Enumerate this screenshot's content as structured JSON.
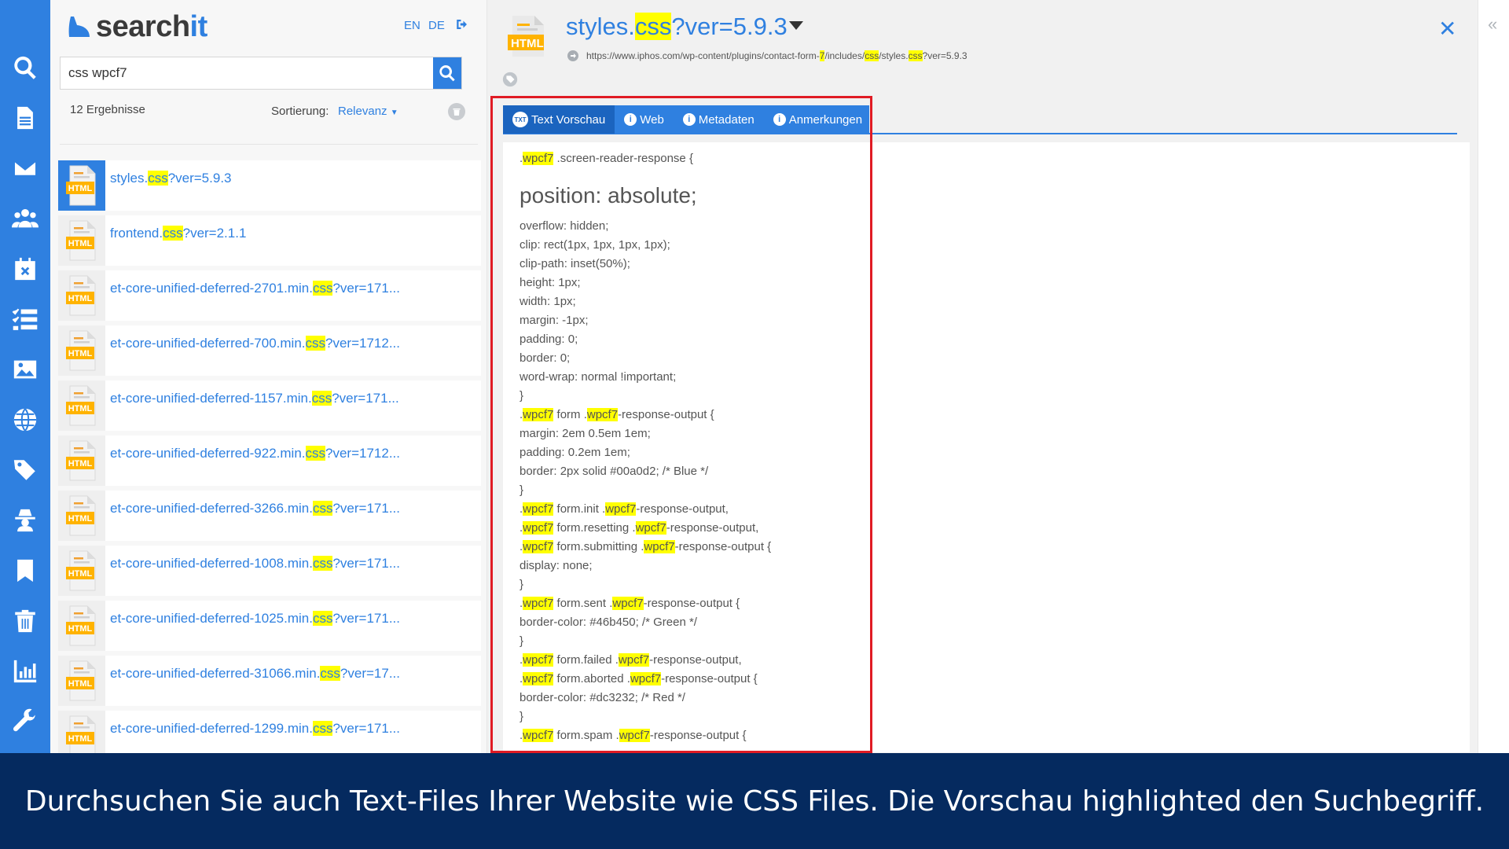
{
  "brand": {
    "name_prefix": "search",
    "name_suffix": "it"
  },
  "lang": {
    "en": "EN",
    "de": "DE"
  },
  "search": {
    "value": "css wpcf7",
    "placeholder": ""
  },
  "results_meta": {
    "count_text": "12 Ergebnisse",
    "sort_label": "Sortierung:",
    "sort_value": "Relevanz"
  },
  "results": [
    {
      "pre": "styles.",
      "hl": "css",
      "post": "?ver=5.9.3",
      "active": true
    },
    {
      "pre": "frontend.",
      "hl": "css",
      "post": "?ver=2.1.1",
      "active": false
    },
    {
      "pre": "et-core-unified-deferred-2701.min.",
      "hl": "css",
      "post": "?ver=171...",
      "active": false
    },
    {
      "pre": "et-core-unified-deferred-700.min.",
      "hl": "css",
      "post": "?ver=1712...",
      "active": false
    },
    {
      "pre": "et-core-unified-deferred-1157.min.",
      "hl": "css",
      "post": "?ver=171...",
      "active": false
    },
    {
      "pre": "et-core-unified-deferred-922.min.",
      "hl": "css",
      "post": "?ver=1712...",
      "active": false
    },
    {
      "pre": "et-core-unified-deferred-3266.min.",
      "hl": "css",
      "post": "?ver=171...",
      "active": false
    },
    {
      "pre": "et-core-unified-deferred-1008.min.",
      "hl": "css",
      "post": "?ver=171...",
      "active": false
    },
    {
      "pre": "et-core-unified-deferred-1025.min.",
      "hl": "css",
      "post": "?ver=171...",
      "active": false
    },
    {
      "pre": "et-core-unified-deferred-31066.min.",
      "hl": "css",
      "post": "?ver=17...",
      "active": false
    },
    {
      "pre": "et-core-unified-deferred-1299.min.",
      "hl": "css",
      "post": "?ver=171...",
      "active": false
    }
  ],
  "file_icon_label": "HTML",
  "detail": {
    "title_pre": "styles.",
    "title_hl": "css",
    "title_post": "?ver=5.9.3",
    "url_parts": [
      {
        "t": "https://www.iphos.com/wp-content/plugins/contact-form-"
      },
      {
        "t": "7",
        "h": true
      },
      {
        "t": "/includes/"
      },
      {
        "t": "css",
        "h": true
      },
      {
        "t": "/styles."
      },
      {
        "t": "css",
        "h": true
      },
      {
        "t": "?ver=5.9.3"
      }
    ]
  },
  "tabs": [
    {
      "label": "Text Vorschau",
      "badge": "TXT",
      "active": true
    },
    {
      "label": "Web",
      "badge": "i",
      "active": false
    },
    {
      "label": "Metadaten",
      "badge": "i",
      "active": false
    },
    {
      "label": "Anmerkungen",
      "badge": "i",
      "active": false
    }
  ],
  "preview_lines": [
    {
      "p": [
        [
          ".",
          0
        ],
        [
          "wpcf7",
          1
        ],
        [
          " .screen-reader-response {",
          0
        ]
      ]
    },
    {
      "big": true,
      "p": [
        [
          "position: absolute;",
          0
        ]
      ]
    },
    {
      "p": [
        [
          "overflow: hidden;",
          0
        ]
      ]
    },
    {
      "p": [
        [
          "clip: rect(1px, 1px, 1px, 1px);",
          0
        ]
      ]
    },
    {
      "p": [
        [
          "clip-path: inset(50%);",
          0
        ]
      ]
    },
    {
      "p": [
        [
          "height: 1px;",
          0
        ]
      ]
    },
    {
      "p": [
        [
          "width: 1px;",
          0
        ]
      ]
    },
    {
      "p": [
        [
          "margin: -1px;",
          0
        ]
      ]
    },
    {
      "p": [
        [
          "padding: 0;",
          0
        ]
      ]
    },
    {
      "p": [
        [
          "border: 0;",
          0
        ]
      ]
    },
    {
      "p": [
        [
          "word-wrap: normal !important;",
          0
        ]
      ]
    },
    {
      "p": [
        [
          "}",
          0
        ]
      ]
    },
    {
      "p": [
        [
          ".",
          0
        ],
        [
          "wpcf7",
          1
        ],
        [
          " form .",
          0
        ],
        [
          "wpcf7",
          1
        ],
        [
          "-response-output {",
          0
        ]
      ]
    },
    {
      "p": [
        [
          "margin: 2em 0.5em 1em;",
          0
        ]
      ]
    },
    {
      "p": [
        [
          "padding: 0.2em 1em;",
          0
        ]
      ]
    },
    {
      "p": [
        [
          "border: 2px solid #00a0d2; /* Blue */",
          0
        ]
      ]
    },
    {
      "p": [
        [
          "}",
          0
        ]
      ]
    },
    {
      "p": [
        [
          ".",
          0
        ],
        [
          "wpcf7",
          1
        ],
        [
          " form.init .",
          0
        ],
        [
          "wpcf7",
          1
        ],
        [
          "-response-output,",
          0
        ]
      ]
    },
    {
      "p": [
        [
          ".",
          0
        ],
        [
          "wpcf7",
          1
        ],
        [
          " form.resetting .",
          0
        ],
        [
          "wpcf7",
          1
        ],
        [
          "-response-output,",
          0
        ]
      ]
    },
    {
      "p": [
        [
          ".",
          0
        ],
        [
          "wpcf7",
          1
        ],
        [
          " form.submitting .",
          0
        ],
        [
          "wpcf7",
          1
        ],
        [
          "-response-output {",
          0
        ]
      ]
    },
    {
      "p": [
        [
          "display: none;",
          0
        ]
      ]
    },
    {
      "p": [
        [
          "}",
          0
        ]
      ]
    },
    {
      "p": [
        [
          ".",
          0
        ],
        [
          "wpcf7",
          1
        ],
        [
          " form.sent .",
          0
        ],
        [
          "wpcf7",
          1
        ],
        [
          "-response-output {",
          0
        ]
      ]
    },
    {
      "p": [
        [
          "border-color: #46b450; /* Green */",
          0
        ]
      ]
    },
    {
      "p": [
        [
          "}",
          0
        ]
      ]
    },
    {
      "p": [
        [
          ".",
          0
        ],
        [
          "wpcf7",
          1
        ],
        [
          " form.failed .",
          0
        ],
        [
          "wpcf7",
          1
        ],
        [
          "-response-output,",
          0
        ]
      ]
    },
    {
      "p": [
        [
          ".",
          0
        ],
        [
          "wpcf7",
          1
        ],
        [
          " form.aborted .",
          0
        ],
        [
          "wpcf7",
          1
        ],
        [
          "-response-output {",
          0
        ]
      ]
    },
    {
      "p": [
        [
          "border-color: #dc3232; /* Red */",
          0
        ]
      ]
    },
    {
      "p": [
        [
          "}",
          0
        ]
      ]
    },
    {
      "p": [
        [
          ".",
          0
        ],
        [
          "wpcf7",
          1
        ],
        [
          " form.spam .",
          0
        ],
        [
          "wpcf7",
          1
        ],
        [
          "-response-output {",
          0
        ]
      ]
    }
  ],
  "banner": "Durchsuchen Sie auch Text-Files Ihrer Website wie CSS Files. Die Vorschau highlighted den Suchbegriff.",
  "colors": {
    "accent": "#2f80e0",
    "highlight": "#ffff00",
    "banner": "#052a5f",
    "annotation_border": "#e01b24"
  },
  "rail_icons": [
    "search-icon",
    "document-icon",
    "mail-icon",
    "users-icon",
    "calendar-icon",
    "checklist-icon",
    "image-icon",
    "globe-icon",
    "tags-icon",
    "spy-icon",
    "bookmark-icon",
    "trash-icon",
    "chart-icon",
    "wrench-icon"
  ]
}
